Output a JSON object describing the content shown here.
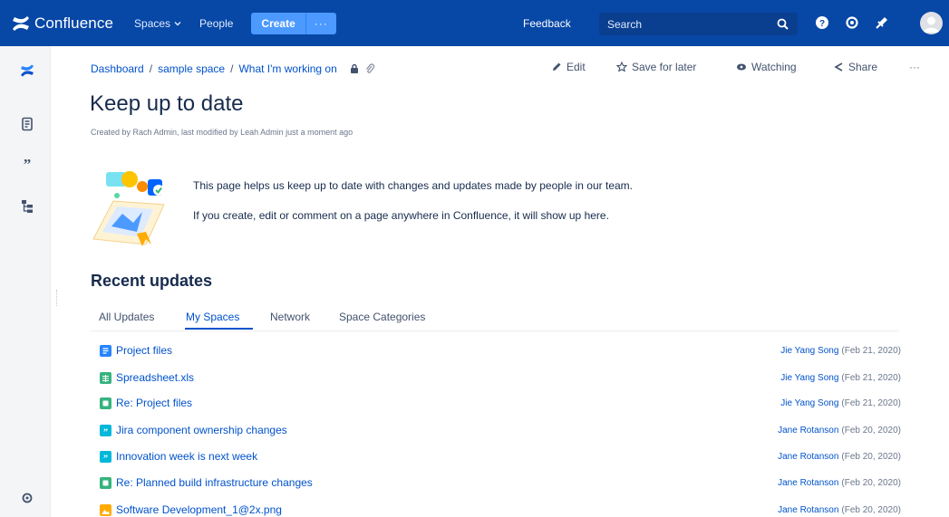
{
  "colors": {
    "topbar": "#0747a6",
    "create": "#4c9aff",
    "link": "#0052cc",
    "text": "#172b4d",
    "muted": "#6b778c",
    "rail": "#f4f5f7"
  },
  "topnav": {
    "brand": "Confluence",
    "spaces": "Spaces",
    "people": "People",
    "create": "Create",
    "more": "···",
    "feedback": "Feedback",
    "search_placeholder": "Search",
    "icons": [
      "search-icon",
      "help-icon",
      "settings-icon",
      "notifications-icon",
      "profile-avatar"
    ]
  },
  "rail": {
    "icons": [
      "confluence-logo-icon",
      "pages-icon",
      "blog-quote-icon",
      "page-tree-icon",
      "settings-gear-icon"
    ]
  },
  "breadcrumb": {
    "items": [
      "Dashboard",
      "sample space",
      "What I'm working on"
    ],
    "separator": "/"
  },
  "actions": {
    "edit": "Edit",
    "save": "Save for later",
    "watching": "Watching",
    "share": "Share",
    "more": "···"
  },
  "page": {
    "title": "Keep up to date",
    "byline": "Created by Rach Admin, last modified by Leah Admin just a moment ago",
    "intro1": "This page helps us keep up to date with changes and updates made by people in our team.",
    "intro2": "If you create, edit or comment on a page anywhere in Confluence, it will show up here."
  },
  "recent": {
    "title": "Recent updates",
    "tabs": [
      "All Updates",
      "My Spaces",
      "Network",
      "Space Categories"
    ],
    "active_tab": "My Spaces",
    "items": [
      {
        "title": "Project files",
        "type": "page",
        "author": "Jie Yang Song",
        "date": "(Feb 21, 2020)"
      },
      {
        "title": "Spreadsheet.xls",
        "type": "spreadsheet",
        "author": "Jie Yang Song",
        "date": "(Feb 21, 2020)"
      },
      {
        "title": "Re: Project files",
        "type": "comment",
        "author": "Jie Yang Song",
        "date": "(Feb 21, 2020)"
      },
      {
        "title": "Jira component ownership changes",
        "type": "blog",
        "author": "Jane Rotanson",
        "date": "(Feb 20, 2020)"
      },
      {
        "title": "Innovation week is next week",
        "type": "blog",
        "author": "Jane Rotanson",
        "date": "(Feb 20, 2020)"
      },
      {
        "title": "Re: Planned build infrastructure changes",
        "type": "comment",
        "author": "Jane Rotanson",
        "date": "(Feb 20, 2020)"
      },
      {
        "title": "Software Development_1@2x.png",
        "type": "image",
        "author": "Jane Rotanson",
        "date": "(Feb 20, 2020)"
      }
    ]
  }
}
